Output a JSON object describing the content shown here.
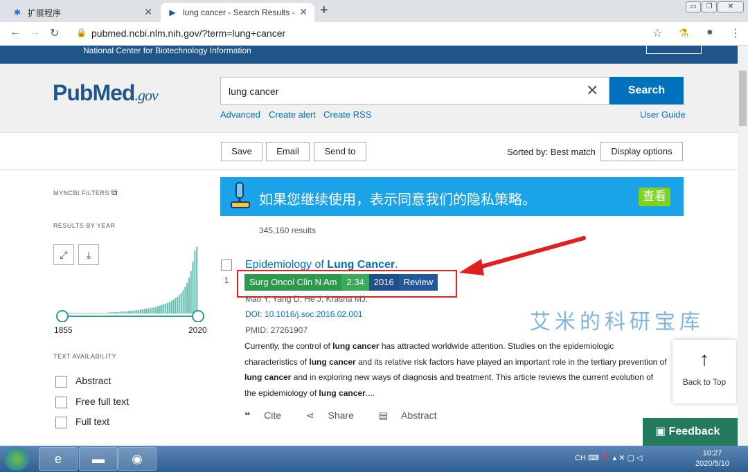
{
  "browser": {
    "tabs": [
      {
        "title": "扩展程序",
        "icon": "puzzle-icon"
      },
      {
        "title": "lung cancer - Search Results -",
        "icon": "pubmed-icon"
      }
    ],
    "url": "pubmed.ncbi.nlm.nih.gov/?term=lung+cancer"
  },
  "header": {
    "ncbi_title": "National Center for Biotechnology Information",
    "logo_pub": "Pub",
    "logo_med": "Med",
    "logo_gov": ".gov"
  },
  "search": {
    "value": "lung cancer",
    "button": "Search",
    "links": [
      "Advanced",
      "Create alert",
      "Create RSS"
    ],
    "user_guide": "User Guide"
  },
  "toolbar": {
    "save": "Save",
    "email": "Email",
    "send_to": "Send to",
    "sorted_by": "Sorted by: Best match",
    "display_options": "Display options"
  },
  "sidebar": {
    "myncbi_filters": "MYNCBI FILTERS",
    "results_by_year": "RESULTS BY YEAR",
    "year_start": "1855",
    "year_end": "2020",
    "text_availability": "TEXT AVAILABILITY",
    "filters": [
      "Abstract",
      "Free full text",
      "Full text"
    ]
  },
  "histogram": [
    1,
    1,
    1,
    1,
    1,
    1,
    1,
    1,
    1,
    1,
    1,
    1,
    1,
    1,
    1,
    1,
    1,
    1,
    1,
    1,
    1,
    1,
    1,
    2,
    2,
    2,
    2,
    2,
    2,
    3,
    3,
    3,
    3,
    4,
    4,
    4,
    5,
    5,
    5,
    6,
    6,
    7,
    7,
    8,
    8,
    9,
    9,
    10,
    11,
    12,
    13,
    14,
    15,
    16,
    17,
    19,
    21,
    23,
    25,
    28,
    31,
    35,
    40,
    46,
    54,
    64,
    78,
    95,
    100
  ],
  "banner": {
    "text": "如果您继续使用，表示同意我们的隐私策略。",
    "button": "查看"
  },
  "results": {
    "count": "345,160 results",
    "item": {
      "number": "1",
      "title_plain": "Epidemiology of ",
      "title_bold": "Lung Cancer",
      "title_end": ".",
      "tags": [
        {
          "label": "Surg Oncol Clin N Am",
          "color": "#2e9a4e"
        },
        {
          "label": "2.34",
          "color": "#3aab5a"
        },
        {
          "label": "2016",
          "color": "#1e4f8a"
        },
        {
          "label": "Review",
          "color": "#24589a"
        }
      ],
      "authors": "Mao Y, Yang D, He J, Krasna MJ.",
      "doi": "DOI: 10.1016/j.soc.2016.02.001",
      "pmid": "PMID: 27261907",
      "abstract": [
        {
          "t": "Currently, the control of "
        },
        {
          "t": "lung cancer",
          "b": true
        },
        {
          "t": " has attracted worldwide attention. Studies on the epidemiologic characteristics of "
        },
        {
          "t": "lung cancer",
          "b": true
        },
        {
          "t": " and its relative risk factors have played an important role in the tertiary prevention of "
        },
        {
          "t": "lung cancer",
          "b": true
        },
        {
          "t": " and in exploring new ways of diagnosis and treatment. This article reviews the current evolution of the epidemiology of "
        },
        {
          "t": "lung cancer",
          "b": true
        },
        {
          "t": "...."
        }
      ],
      "actions": [
        "Cite",
        "Share",
        "Abstract"
      ]
    }
  },
  "watermark": "艾米的科研宝库",
  "back_to_top": "Back to Top",
  "feedback": "Feedback",
  "taskbar": {
    "clock_time": "10:27",
    "clock_date": "2020/5/10",
    "lang": "CH"
  },
  "colors": {
    "ncbi_blue": "#20558a",
    "link_blue": "#0071bc",
    "feedback_green": "#237a5c",
    "annotation_red": "#e02020"
  }
}
